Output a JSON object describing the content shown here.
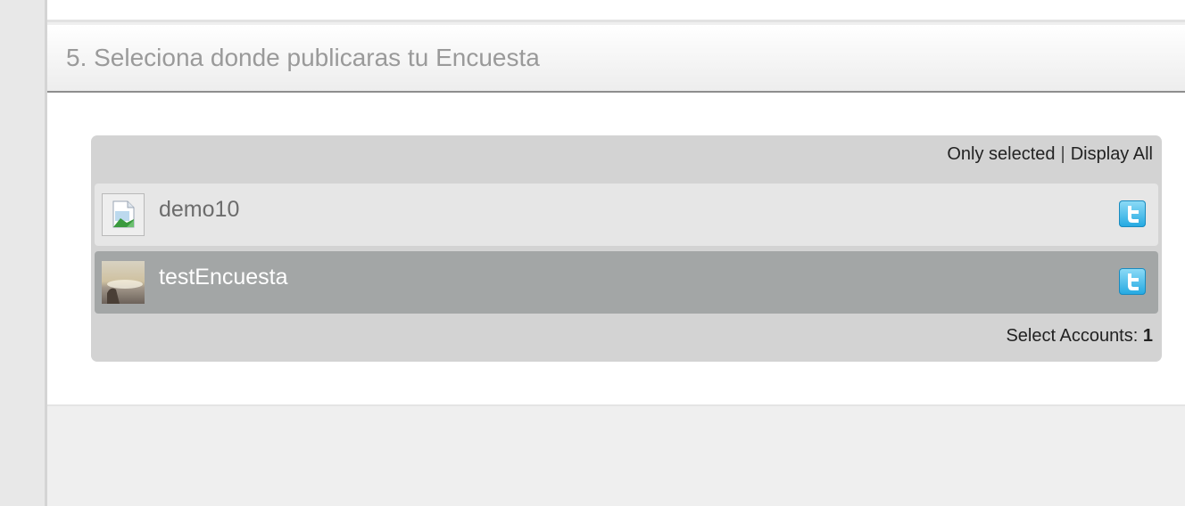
{
  "section": {
    "title": "5. Seleciona donde publicaras tu Encuesta"
  },
  "filters": {
    "only_selected": "Only selected",
    "separator": "|",
    "display_all": "Display All"
  },
  "accounts": [
    {
      "name": "demo10",
      "network_icon": "twitter-icon",
      "avatar": "placeholder-image-icon",
      "selected": false
    },
    {
      "name": "testEncuesta",
      "network_icon": "twitter-icon",
      "avatar": "sunset-photo",
      "selected": true
    }
  ],
  "footer": {
    "label": "Select Accounts:",
    "count": "1"
  },
  "colors": {
    "selected_row": "#a3a6a6",
    "unselected_row": "#e6e6e6",
    "twitter_blue": "#22a8e1"
  }
}
